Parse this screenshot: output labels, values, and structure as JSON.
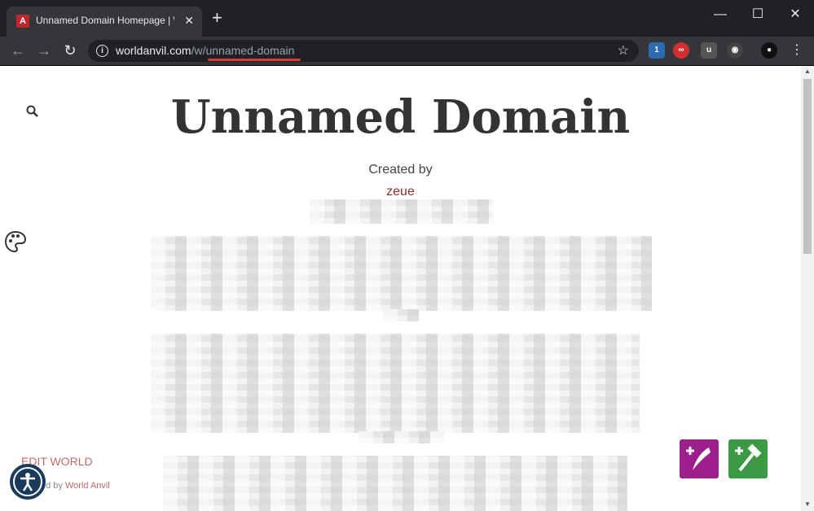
{
  "browser": {
    "tab_title": "Unnamed Domain Homepage | W",
    "tab_favicon": "A",
    "url_host": "worldanvil.com",
    "url_path": "/w/unnamed-domain",
    "extension_badge": "1",
    "icons": [
      "back-icon",
      "forward-icon",
      "reload-icon",
      "info-icon",
      "star-icon",
      "menu-icon"
    ]
  },
  "page": {
    "title": "Unnamed Domain",
    "created_by_label": "Created by",
    "author": "zeue",
    "edit_world": "EDIT WORLD",
    "powered_by_prefix": "ed by",
    "powered_by_link": "World Anvil"
  },
  "colors": {
    "accent_red": "#e53935",
    "author": "#8b2d2d",
    "fab_purple": "#9c1f8c",
    "fab_green": "#3b9a43"
  }
}
